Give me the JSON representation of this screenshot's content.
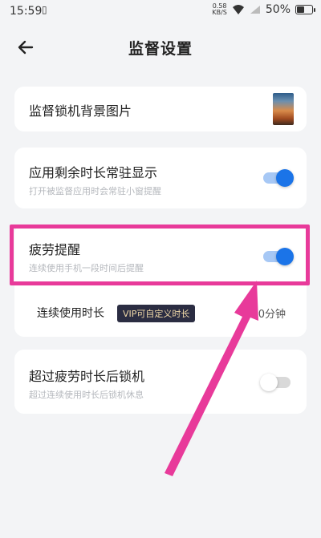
{
  "status_bar": {
    "time": "15:59",
    "net_speed_value": "0.58",
    "net_speed_unit": "KB/S",
    "battery_percent": "50%",
    "battery_level": 0.5
  },
  "header": {
    "title": "监督设置"
  },
  "settings": {
    "background_image": {
      "title": "监督锁机背景图片"
    },
    "app_remaining_time": {
      "title": "应用剩余时长常驻显示",
      "subtitle": "打开被监督应用时会常驻小窗提醒",
      "enabled": true
    },
    "fatigue_reminder": {
      "title": "疲劳提醒",
      "subtitle": "连续使用手机一段时间后提醒",
      "enabled": true,
      "duration_label": "连续使用时长",
      "vip_badge": "VIP可自定义时长",
      "duration_value": "30分钟"
    },
    "lock_after_fatigue": {
      "title": "超过疲劳时长后锁机",
      "subtitle": "超过连续使用时长后锁机休息",
      "enabled": false
    }
  },
  "colors": {
    "accent_blue": "#1b74e8",
    "highlight_pink": "#e83a9a",
    "vip_bg": "#2b2d42",
    "vip_text": "#f0d9a8"
  }
}
